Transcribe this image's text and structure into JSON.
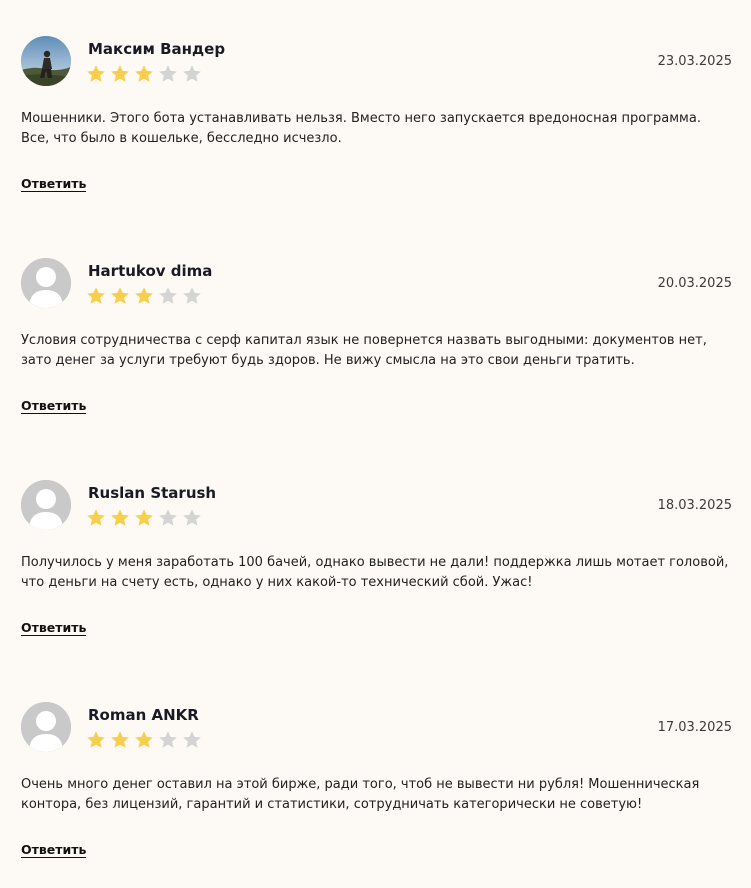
{
  "reviews": [
    {
      "author": "Максим Вандер",
      "avatar": "photo",
      "rating": 3,
      "max_rating": 5,
      "date": "23.03.2025",
      "text": "Мошенники. Этого бота устанавливать нельзя. Вместо него запускается вредоносная программа. Все, что было в кошельке, бесследно исчезло.",
      "reply_label": "Ответить"
    },
    {
      "author": "Hartukov dima",
      "avatar": "default-user",
      "rating": 3,
      "max_rating": 5,
      "date": "20.03.2025",
      "text": "Условия сотрудничества с серф капитал язык не повернется назвать выгодными: документов нет, зато денег за услуги требуют будь здоров. Не вижу смысла на это свои деньги тратить.",
      "reply_label": "Ответить"
    },
    {
      "author": "Ruslan Starush",
      "avatar": "default-user",
      "rating": 3,
      "max_rating": 5,
      "date": "18.03.2025",
      "text": "Получилось у меня заработать 100 бачей, однако вывести не дали! поддержка лишь мотает головой, что деньги на счету есть, однако у них какой-то технический сбой. Ужас!",
      "reply_label": "Ответить"
    },
    {
      "author": "Roman ANKR",
      "avatar": "default-user",
      "rating": 3,
      "max_rating": 5,
      "date": "17.03.2025",
      "text": "Очень много денег оставил на этой бирже, ради того, чтоб не вывести ни рубля! Мошенническая контора, без лицензий, гарантий и статистики, сотрудничать категорически не советую!",
      "reply_label": "Ответить"
    }
  ],
  "colors": {
    "background": "#fdf9f5",
    "star_filled": "#f7cf4c",
    "star_empty": "#d4d4d4",
    "avatar_placeholder": "#c9c9c9"
  }
}
